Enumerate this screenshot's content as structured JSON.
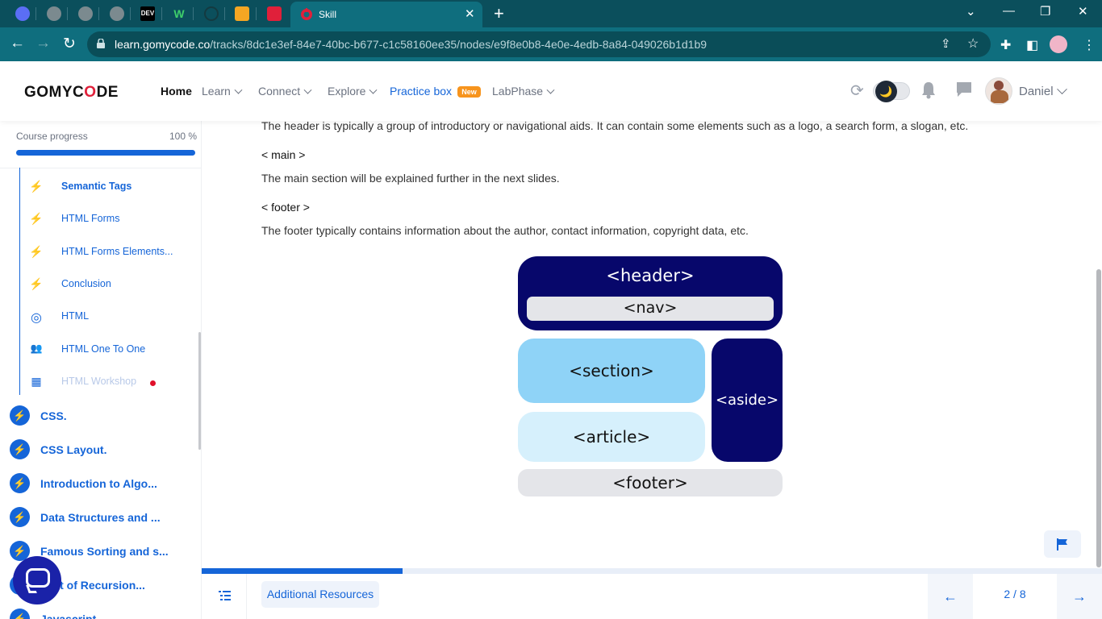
{
  "browser": {
    "tab_title": "Skill",
    "close_glyph": "✕",
    "newtab_glyph": "+",
    "url_domain": "learn.gomycode.co",
    "url_path": "/tracks/8dc1e3ef-84e7-40bc-b677-c1c58160ee35/nodes/e9f8e0b8-4e0e-4edb-8a84-049026b1d1b9",
    "inactive_tabs": [
      "tab-icon-1",
      "tab-icon-2",
      "tab-icon-3",
      "tab-icon-4",
      "DEV",
      "W",
      "tab-icon-7",
      "tab-icon-8",
      "tab-icon-9"
    ],
    "controls": {
      "back": "←",
      "forward": "→",
      "reload": "↻",
      "minimize": "—",
      "restore": "❐",
      "close": "✕",
      "chevron": "⌄"
    }
  },
  "site": {
    "logo": "GOMYCODE",
    "nav": {
      "home": "Home",
      "learn": "Learn",
      "connect": "Connect",
      "explore": "Explore",
      "practice": "Practice box",
      "practice_badge": "New",
      "labphase": "LabPhase"
    },
    "user_name": "Daniel",
    "theme_toggle_glyph": "🌙",
    "accent_color": "#1565d8",
    "brand_red": "#e0203a"
  },
  "sidebar": {
    "progress_label": "Course progress",
    "progress_text": "100 %",
    "progress_value": 1.0,
    "sub_items": [
      {
        "label": "Semantic Tags",
        "icon": "bolt-icon",
        "glyph": "⚡"
      },
      {
        "label": "HTML Forms",
        "icon": "bolt-icon",
        "glyph": "⚡"
      },
      {
        "label": "HTML Forms Elements...",
        "icon": "bolt-icon",
        "glyph": "⚡"
      },
      {
        "label": "Conclusion",
        "icon": "bolt-icon",
        "glyph": "⚡"
      },
      {
        "label": "HTML",
        "icon": "target-icon",
        "glyph": "◎"
      },
      {
        "label": "HTML One To One",
        "icon": "people-icon",
        "glyph": "👥"
      },
      {
        "label": "HTML Workshop",
        "icon": "workshop-icon",
        "glyph": "▦"
      }
    ],
    "courses": [
      {
        "label": "CSS.",
        "icon": "bolt-icon",
        "glyph": "⚡"
      },
      {
        "label": "CSS Layout.",
        "icon": "bolt-icon",
        "glyph": "⚡"
      },
      {
        "label": "Introduction to Algo...",
        "icon": "bolt-icon",
        "glyph": "⚡"
      },
      {
        "label": "Data Structures and ...",
        "icon": "bolt-icon",
        "glyph": "⚡"
      },
      {
        "label": "Famous Sorting and s...",
        "icon": "bolt-icon",
        "glyph": "⚡"
      },
      {
        "label": "cept of Recursion...",
        "icon": "bolt-icon",
        "glyph": "⚡"
      },
      {
        "label": "Javascript",
        "icon": "bolt-icon",
        "glyph": "⚡"
      }
    ]
  },
  "content": {
    "p1": "The header is typically a group of introductory or navigational aids. It can contain some elements such as a logo, a search form, a slogan, etc.",
    "h_main": "< main >",
    "p2": "The main section will be explained further in the next slides.",
    "h_footer": "< footer >",
    "p3": "The footer typically contains information about the author, contact information, copyright data, etc.",
    "diagram": {
      "header": "<header>",
      "nav": "<nav>",
      "section": "<section>",
      "article": "<article>",
      "aside": "<aside>",
      "footer": "<footer>"
    }
  },
  "bottom": {
    "slide_progress": 0.223,
    "additional_resources": "Additional Resources",
    "pager": "2 / 8",
    "prev_glyph": "←",
    "next_glyph": "→"
  }
}
